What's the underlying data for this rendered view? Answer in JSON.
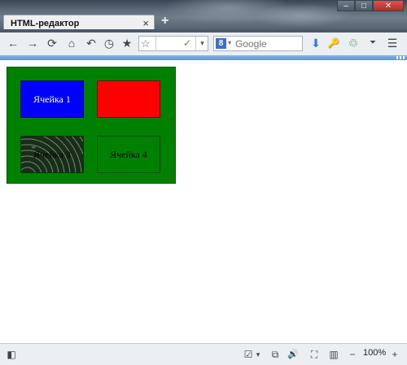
{
  "window": {
    "tab_title": "HTML-редактор",
    "tab_close": "×",
    "new_tab": "+",
    "buttons": {
      "minimize": "–",
      "maximize": "□",
      "close": "✕"
    }
  },
  "toolbar": {
    "back": "←",
    "forward": "→",
    "reload": "⟳",
    "home": "⌂",
    "undo": "↶",
    "history": "◷",
    "bookmark": "★",
    "url_star": "☆",
    "url_leaf": "✓",
    "url_drop": "▾",
    "search_engine_badge": "8",
    "search_engine_caret": "▾",
    "search_placeholder": "Google",
    "download": "⬇",
    "key": "🔑",
    "addon": "♲",
    "overflow": "⏷",
    "menu": "☰"
  },
  "table": {
    "cells": [
      "Ячейка 1",
      "",
      "Ячейка 3",
      "Ячейка 4"
    ],
    "colors": {
      "table_bg": "#008000",
      "cell1": "#0000ff",
      "cell2": "#ff0000",
      "cell4": "#008000"
    }
  },
  "statusbar": {
    "sidebar_toggle": "◧",
    "checkbox": "☑",
    "checkbox_caret": "▾",
    "screenshot": "⧉",
    "volume": "🔊",
    "fullscreen": "⛶",
    "split": "▥",
    "zoom_out": "−",
    "zoom_level": "100%",
    "zoom_in": "+"
  }
}
